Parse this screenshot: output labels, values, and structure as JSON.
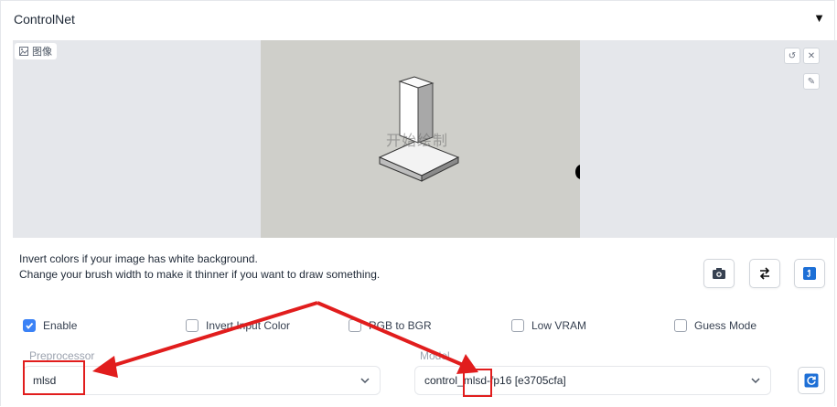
{
  "header": {
    "title": "ControlNet",
    "collapse_glyph": "▼"
  },
  "image_panel": {
    "label": "图像",
    "label_icon": "image-icon",
    "canvas_overlay_text": "开始绘制",
    "tools": {
      "undo": "↺",
      "clear": "✕",
      "brush": "✎"
    }
  },
  "info": {
    "line1": "Invert colors if your image has white background.",
    "line2": "Change your brush width to make it thinner if you want to draw something."
  },
  "actions": {
    "camera_icon": "camera-icon",
    "swap_icon": "swap-icon",
    "send_icon": "send-dimensions-icon"
  },
  "options": {
    "enable": {
      "label": "Enable",
      "checked": true
    },
    "invert_input_color": {
      "label": "Invert Input Color",
      "checked": false
    },
    "rgb_to_bgr": {
      "label": "RGB to BGR",
      "checked": false
    },
    "low_vram": {
      "label": "Low VRAM",
      "checked": false
    },
    "guess_mode": {
      "label": "Guess Mode",
      "checked": false
    }
  },
  "preprocessor": {
    "label": "Preprocessor",
    "value": "mlsd"
  },
  "model": {
    "label": "Model",
    "value": "control_mlsd-fp16 [e3705cfa]"
  },
  "colors": {
    "accent": "#3b82f6",
    "annotation": "#e11d1d",
    "canvas_bg": "#cfcfca"
  }
}
